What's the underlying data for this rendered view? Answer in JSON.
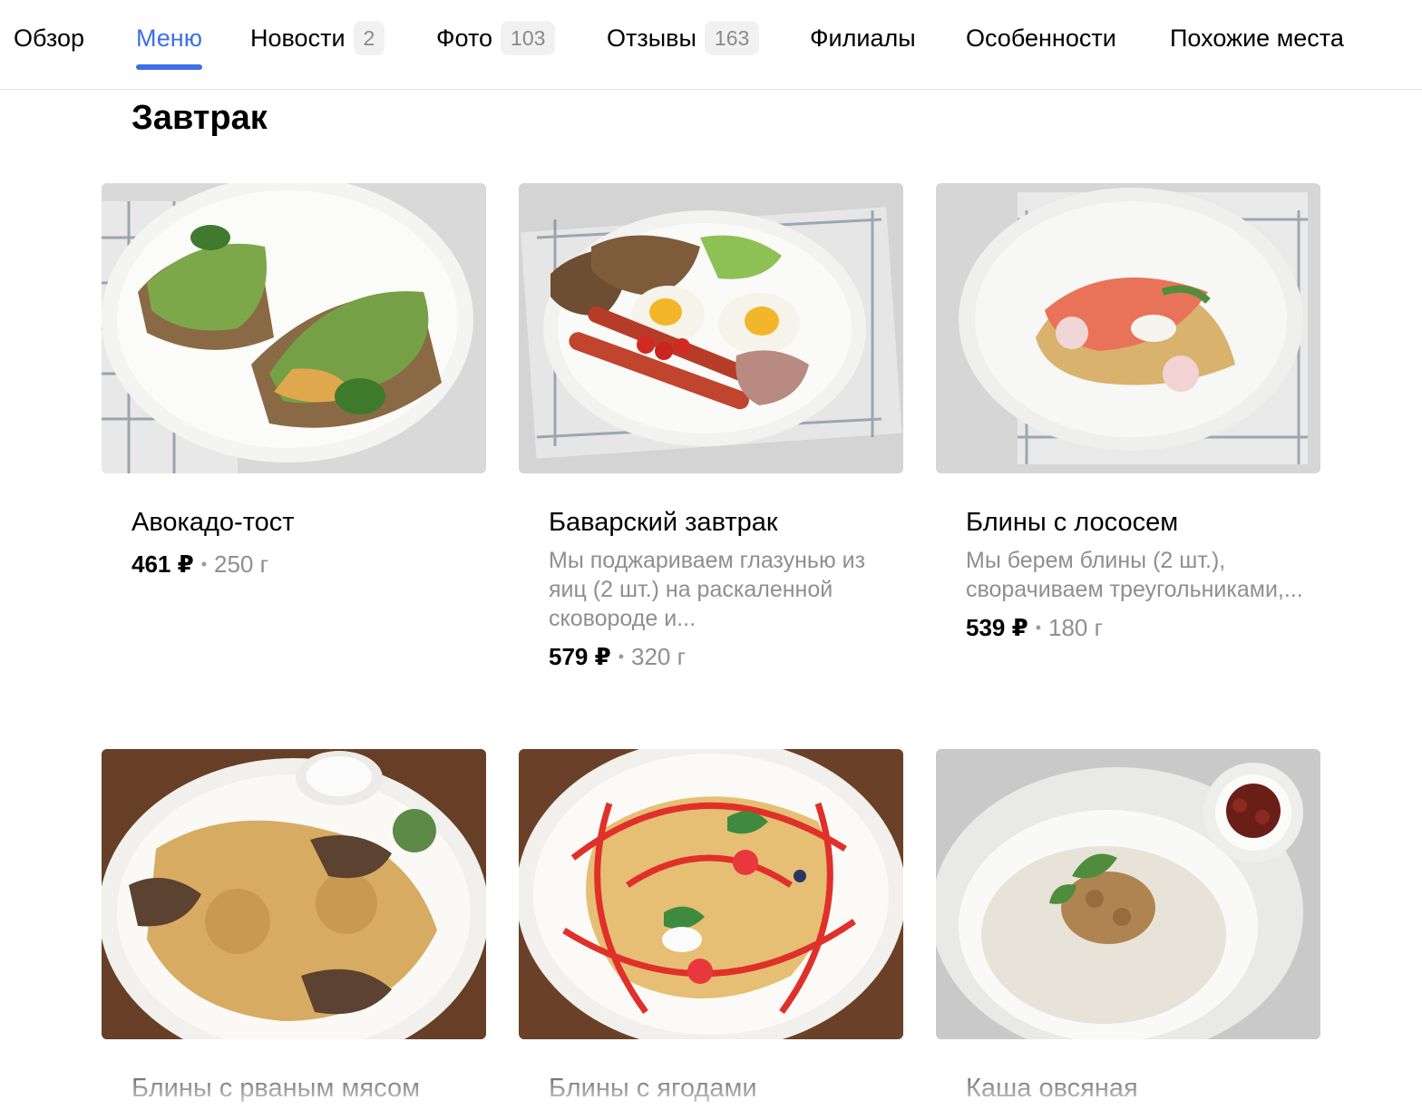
{
  "tabs": [
    {
      "label": "Обзор"
    },
    {
      "label": "Меню"
    },
    {
      "label": "Новости",
      "count": "2"
    },
    {
      "label": "Фото",
      "count": "103"
    },
    {
      "label": "Отзывы",
      "count": "163"
    },
    {
      "label": "Филиалы"
    },
    {
      "label": "Особенности"
    },
    {
      "label": "Похожие места"
    }
  ],
  "active_tab": "Меню",
  "section": {
    "title": "Завтрак"
  },
  "items": [
    {
      "name": "Авокадо-тост",
      "price": "461 ₽",
      "weight": "250 г"
    },
    {
      "name": "Баварский завтрак",
      "description": "Мы поджариваем глазунью из яиц (2 шт.) на раскаленной сковороде и...",
      "price": "579 ₽",
      "weight": "320 г"
    },
    {
      "name": "Блины с лососем",
      "description": "Мы берем блины (2 шт.), сворачиваем треугольниками,...",
      "price": "539 ₽",
      "weight": "180 г"
    },
    {
      "name": "Блины с рваным мясом"
    },
    {
      "name": "Блины с ягодами"
    },
    {
      "name": "Каша овсяная"
    }
  ],
  "separator": "•",
  "colors": {
    "accent": "#3f6ee6",
    "muted_text": "#8f8f8f",
    "badge_bg": "#f1f1f1"
  }
}
